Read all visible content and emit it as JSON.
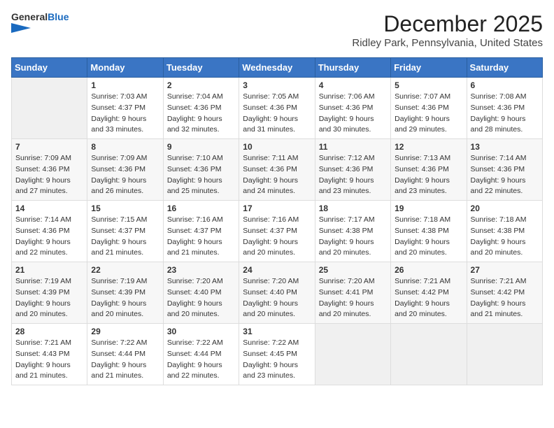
{
  "header": {
    "logo_line1": "General",
    "logo_line2": "Blue",
    "month_title": "December 2025",
    "location": "Ridley Park, Pennsylvania, United States"
  },
  "days_of_week": [
    "Sunday",
    "Monday",
    "Tuesday",
    "Wednesday",
    "Thursday",
    "Friday",
    "Saturday"
  ],
  "weeks": [
    [
      {
        "day": "",
        "info": ""
      },
      {
        "day": "1",
        "info": "Sunrise: 7:03 AM\nSunset: 4:37 PM\nDaylight: 9 hours\nand 33 minutes."
      },
      {
        "day": "2",
        "info": "Sunrise: 7:04 AM\nSunset: 4:36 PM\nDaylight: 9 hours\nand 32 minutes."
      },
      {
        "day": "3",
        "info": "Sunrise: 7:05 AM\nSunset: 4:36 PM\nDaylight: 9 hours\nand 31 minutes."
      },
      {
        "day": "4",
        "info": "Sunrise: 7:06 AM\nSunset: 4:36 PM\nDaylight: 9 hours\nand 30 minutes."
      },
      {
        "day": "5",
        "info": "Sunrise: 7:07 AM\nSunset: 4:36 PM\nDaylight: 9 hours\nand 29 minutes."
      },
      {
        "day": "6",
        "info": "Sunrise: 7:08 AM\nSunset: 4:36 PM\nDaylight: 9 hours\nand 28 minutes."
      }
    ],
    [
      {
        "day": "7",
        "info": "Sunrise: 7:09 AM\nSunset: 4:36 PM\nDaylight: 9 hours\nand 27 minutes."
      },
      {
        "day": "8",
        "info": "Sunrise: 7:09 AM\nSunset: 4:36 PM\nDaylight: 9 hours\nand 26 minutes."
      },
      {
        "day": "9",
        "info": "Sunrise: 7:10 AM\nSunset: 4:36 PM\nDaylight: 9 hours\nand 25 minutes."
      },
      {
        "day": "10",
        "info": "Sunrise: 7:11 AM\nSunset: 4:36 PM\nDaylight: 9 hours\nand 24 minutes."
      },
      {
        "day": "11",
        "info": "Sunrise: 7:12 AM\nSunset: 4:36 PM\nDaylight: 9 hours\nand 23 minutes."
      },
      {
        "day": "12",
        "info": "Sunrise: 7:13 AM\nSunset: 4:36 PM\nDaylight: 9 hours\nand 23 minutes."
      },
      {
        "day": "13",
        "info": "Sunrise: 7:14 AM\nSunset: 4:36 PM\nDaylight: 9 hours\nand 22 minutes."
      }
    ],
    [
      {
        "day": "14",
        "info": "Sunrise: 7:14 AM\nSunset: 4:36 PM\nDaylight: 9 hours\nand 22 minutes."
      },
      {
        "day": "15",
        "info": "Sunrise: 7:15 AM\nSunset: 4:37 PM\nDaylight: 9 hours\nand 21 minutes."
      },
      {
        "day": "16",
        "info": "Sunrise: 7:16 AM\nSunset: 4:37 PM\nDaylight: 9 hours\nand 21 minutes."
      },
      {
        "day": "17",
        "info": "Sunrise: 7:16 AM\nSunset: 4:37 PM\nDaylight: 9 hours\nand 20 minutes."
      },
      {
        "day": "18",
        "info": "Sunrise: 7:17 AM\nSunset: 4:38 PM\nDaylight: 9 hours\nand 20 minutes."
      },
      {
        "day": "19",
        "info": "Sunrise: 7:18 AM\nSunset: 4:38 PM\nDaylight: 9 hours\nand 20 minutes."
      },
      {
        "day": "20",
        "info": "Sunrise: 7:18 AM\nSunset: 4:38 PM\nDaylight: 9 hours\nand 20 minutes."
      }
    ],
    [
      {
        "day": "21",
        "info": "Sunrise: 7:19 AM\nSunset: 4:39 PM\nDaylight: 9 hours\nand 20 minutes."
      },
      {
        "day": "22",
        "info": "Sunrise: 7:19 AM\nSunset: 4:39 PM\nDaylight: 9 hours\nand 20 minutes."
      },
      {
        "day": "23",
        "info": "Sunrise: 7:20 AM\nSunset: 4:40 PM\nDaylight: 9 hours\nand 20 minutes."
      },
      {
        "day": "24",
        "info": "Sunrise: 7:20 AM\nSunset: 4:40 PM\nDaylight: 9 hours\nand 20 minutes."
      },
      {
        "day": "25",
        "info": "Sunrise: 7:20 AM\nSunset: 4:41 PM\nDaylight: 9 hours\nand 20 minutes."
      },
      {
        "day": "26",
        "info": "Sunrise: 7:21 AM\nSunset: 4:42 PM\nDaylight: 9 hours\nand 20 minutes."
      },
      {
        "day": "27",
        "info": "Sunrise: 7:21 AM\nSunset: 4:42 PM\nDaylight: 9 hours\nand 21 minutes."
      }
    ],
    [
      {
        "day": "28",
        "info": "Sunrise: 7:21 AM\nSunset: 4:43 PM\nDaylight: 9 hours\nand 21 minutes."
      },
      {
        "day": "29",
        "info": "Sunrise: 7:22 AM\nSunset: 4:44 PM\nDaylight: 9 hours\nand 21 minutes."
      },
      {
        "day": "30",
        "info": "Sunrise: 7:22 AM\nSunset: 4:44 PM\nDaylight: 9 hours\nand 22 minutes."
      },
      {
        "day": "31",
        "info": "Sunrise: 7:22 AM\nSunset: 4:45 PM\nDaylight: 9 hours\nand 23 minutes."
      },
      {
        "day": "",
        "info": ""
      },
      {
        "day": "",
        "info": ""
      },
      {
        "day": "",
        "info": ""
      }
    ]
  ]
}
